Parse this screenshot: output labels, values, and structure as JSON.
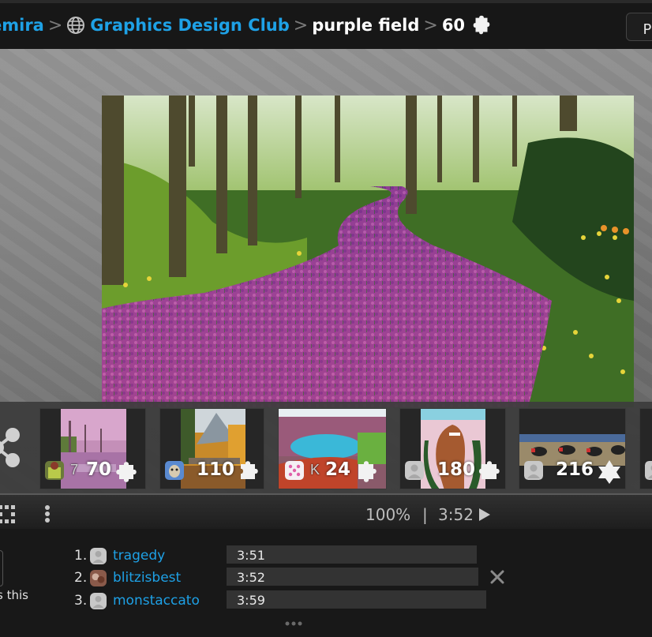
{
  "breadcrumb": {
    "items": [
      {
        "label": "emira",
        "type": "link"
      },
      {
        "label": "Graphics Design Club",
        "type": "link",
        "icon": "globe-icon"
      },
      {
        "label": "purple field",
        "type": "current"
      },
      {
        "label": "60",
        "type": "current",
        "icon": "puzzle-piece-icon"
      }
    ],
    "separator": ">"
  },
  "header": {
    "play_button_label": "Pla"
  },
  "puzzle": {
    "title": "purple field",
    "piece_count": "60",
    "image_description": "Winding river of purple and pink tulips through a green forest"
  },
  "tray": {
    "share_icon": "share-icon",
    "cards": [
      {
        "pieces": "70",
        "rank_hint": "7",
        "avatar": "user-avatar-photo",
        "piece_icon": "puzzle-piece-icon",
        "thumb_desc": "pink cherry blossom alley"
      },
      {
        "pieces": "110",
        "rank_hint": "",
        "avatar": "user-avatar-photo",
        "piece_icon": "puzzle-piece-icon",
        "thumb_desc": "autumn mountain with bridge"
      },
      {
        "pieces": "24",
        "rank_hint": "K",
        "avatar": "user-avatar-dice",
        "piece_icon": "puzzle-piece-icon",
        "thumb_desc": "crater lake"
      },
      {
        "pieces": "180",
        "rank_hint": "",
        "avatar": "default-avatar",
        "piece_icon": "puzzle-piece-icon",
        "thumb_desc": "racehorse with flower garland"
      },
      {
        "pieces": "216",
        "rank_hint": "",
        "avatar": "default-avatar",
        "piece_icon": "star-piece-icon",
        "thumb_desc": "harness racing"
      }
    ]
  },
  "toolbar": {
    "zoom_level": "100%",
    "separator": "|",
    "timer": "3:52",
    "grid_icon": "grid-icon",
    "menu_icon": "kebab-menu-icon",
    "play_icon": "play-icon"
  },
  "sidebar_partial": {
    "text": "s this"
  },
  "leaderboard": {
    "entries": [
      {
        "rank": "1.",
        "name": "tragedy",
        "time": "3:51",
        "avatar": "default-avatar",
        "bar_fraction": 0.946
      },
      {
        "rank": "2.",
        "name": "blitzisbest",
        "time": "3:52",
        "avatar": "user-avatar-photo",
        "bar_fraction": 0.95,
        "removable": true
      },
      {
        "rank": "3.",
        "name": "monstaccato",
        "time": "3:59",
        "avatar": "default-avatar",
        "bar_fraction": 0.98
      }
    ],
    "more_label": "more"
  },
  "colors": {
    "link": "#1ea1e6",
    "header_bg": "#171717",
    "toolbar_text": "#bdbdbd",
    "bar_bg": "#333333"
  }
}
